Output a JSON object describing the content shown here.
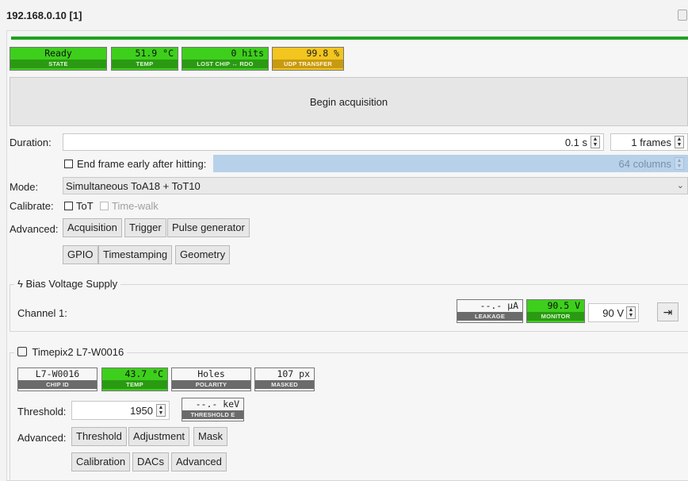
{
  "window": {
    "title": "192.168.0.10 [1]"
  },
  "status": {
    "state": {
      "value": "Ready",
      "caption": "STATE"
    },
    "temp": {
      "value": "51.9 °C",
      "caption": "TEMP"
    },
    "lost": {
      "value": "0 hits",
      "caption": "LOST CHIP ↔ RDO"
    },
    "udp": {
      "value": "99.8 %",
      "caption": "UDP TRANSFER"
    },
    "progress_fraction": 1.0
  },
  "begin_label": "Begin acquisition",
  "duration": {
    "label": "Duration:",
    "seconds": "0.1 s",
    "frames": "1 frames"
  },
  "end_early": {
    "label": "End frame early after hitting:",
    "checked": false,
    "columns": "64 columns"
  },
  "mode": {
    "label": "Mode:",
    "value": "Simultaneous ToA18 + ToT10"
  },
  "calibrate": {
    "label": "Calibrate:",
    "tot": "ToT",
    "timewalk": "Time-walk"
  },
  "advanced": {
    "label": "Advanced:",
    "row1": [
      "Acquisition",
      "Trigger",
      "Pulse generator"
    ],
    "row2": [
      "GPIO",
      "Timestamping",
      "Geometry"
    ]
  },
  "bias": {
    "title": "Bias Voltage Supply",
    "channel_label": "Channel 1:",
    "leakage": {
      "value": "--.- µA",
      "caption": "LEAKAGE"
    },
    "monitor": {
      "value": "90.5 V",
      "caption": "MONITOR"
    },
    "setpoint": "90 V"
  },
  "chip": {
    "title": "Timepix2 L7-W0016",
    "chip_id": {
      "value": "L7-W0016",
      "caption": "CHIP ID"
    },
    "temp": {
      "value": "43.7 °C",
      "caption": "TEMP"
    },
    "polarity": {
      "value": "Holes",
      "caption": "POLARITY"
    },
    "masked": {
      "value": "107 px",
      "caption": "MASKED"
    },
    "threshold_label": "Threshold:",
    "threshold_value": "1950",
    "threshold_e": {
      "value": "--.- keV",
      "caption": "THRESHOLD E"
    },
    "advanced_label": "Advanced:",
    "row1": [
      "Threshold",
      "Adjustment",
      "Mask"
    ],
    "row2": [
      "Calibration",
      "DACs",
      "Advanced"
    ]
  },
  "colors": {
    "ok_green": "#3ecf1c",
    "warn_yellow": "#f2c51f",
    "progress_green": "#21a021",
    "selection_blue": "#b7d1ea"
  }
}
